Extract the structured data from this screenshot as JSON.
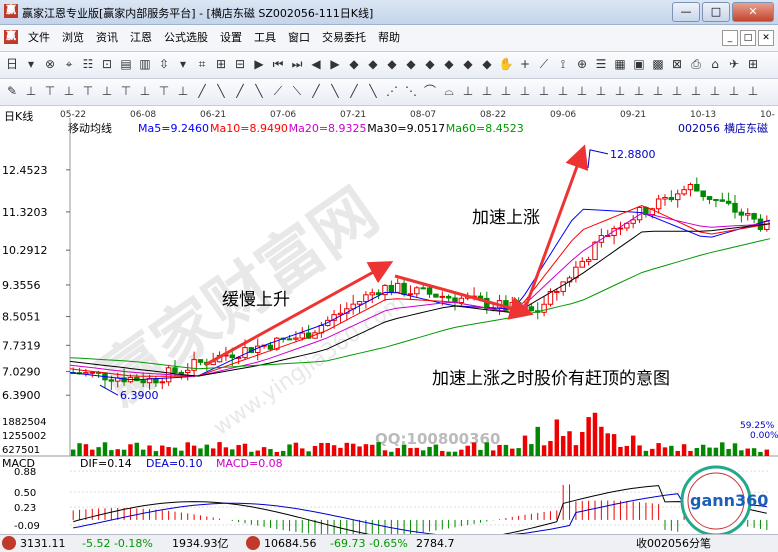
{
  "window": {
    "title": "赢家江恩专业版[赢家内部服务平台] - [横店东磁  SZ002056-111日K线]",
    "app_icon": "赢"
  },
  "window_buttons": [
    "—",
    "□",
    "✕"
  ],
  "menu": {
    "icon": "赢",
    "items": [
      "文件",
      "浏览",
      "资讯",
      "江恩",
      "公式选股",
      "设置",
      "工具",
      "窗口",
      "交易委托",
      "帮助"
    ],
    "mdi": [
      "_",
      "□",
      "✕"
    ]
  },
  "toolbar1": [
    {
      "icon": "日"
    },
    {
      "icon": "▾"
    },
    {
      "icon": "⊗"
    },
    {
      "icon": "⌖"
    },
    {
      "icon": "☷"
    },
    {
      "icon": "⊡"
    },
    {
      "icon": "▤"
    },
    {
      "icon": "▥"
    },
    {
      "icon": "⇳"
    },
    {
      "icon": "▾"
    },
    {
      "icon": "⌗"
    },
    {
      "icon": "⊞"
    },
    {
      "icon": "⊟"
    },
    {
      "icon": "▶"
    },
    {
      "icon": "⏮"
    },
    {
      "icon": "⏭"
    },
    {
      "icon": "◀"
    },
    {
      "icon": "▶"
    },
    {
      "icon": "◆"
    },
    {
      "icon": "◆"
    },
    {
      "icon": "◆"
    },
    {
      "icon": "◆"
    },
    {
      "icon": "◆"
    },
    {
      "icon": "◆"
    },
    {
      "icon": "◆"
    },
    {
      "icon": "◆"
    },
    {
      "icon": "✋"
    },
    {
      "icon": "+"
    },
    {
      "icon": "⟋"
    },
    {
      "icon": "⟟"
    },
    {
      "icon": "⊕"
    },
    {
      "icon": "☰"
    },
    {
      "icon": "▦"
    },
    {
      "icon": "▣"
    },
    {
      "icon": "▩"
    },
    {
      "icon": "⊠"
    },
    {
      "icon": "⎙"
    },
    {
      "icon": "⌂"
    },
    {
      "icon": "✈"
    },
    {
      "icon": "⊞"
    }
  ],
  "toolbar2": [
    "✎",
    "⊥",
    "⊤",
    "⊥",
    "⊤",
    "⊥",
    "⊤",
    "⊥",
    "⊤",
    "⊥",
    "╱",
    "╲",
    "╱",
    "╲",
    "⟋",
    "⟍",
    "╱",
    "╲",
    "╱",
    "╲",
    "⋰",
    "⋱",
    "⌒",
    "⌓",
    "⊥",
    "⊥",
    "⊥",
    "⊥",
    "⊥",
    "⊥",
    "⊥",
    "⊥",
    "⊥",
    "⊥",
    "⊥",
    "⊥",
    "⊥",
    "⊥",
    "⊥",
    "⊥"
  ],
  "chart": {
    "period_label": "日K线",
    "indicator_name": "移动均线",
    "ma_legend": [
      {
        "text": "Ma5=9.2460",
        "color": "#0000ff"
      },
      {
        "text": "Ma10=8.9490",
        "color": "#ff0000"
      },
      {
        "text": "Ma20=8.9325",
        "color": "#cc00cc"
      },
      {
        "text": "Ma30=9.0517",
        "color": "#000000"
      },
      {
        "text": "Ma60=8.4523",
        "color": "#009900"
      }
    ],
    "stock_code": "002056",
    "stock_name": "横店东磁",
    "date_ticks": [
      "05-22",
      "06-08",
      "06-21",
      "07-06",
      "07-21",
      "08-07",
      "08-22",
      "09-06",
      "09-21",
      "10-13",
      "10-"
    ],
    "price_ticks": [
      "12.4523",
      "11.3203",
      "10.2912",
      "9.3556",
      "8.5051",
      "7.7319",
      "7.0290",
      "6.3900"
    ],
    "price_range": [
      6.1,
      13.2
    ],
    "high_label": "12.8800",
    "low_label": "6.3900",
    "volume_ticks": [
      "1882504",
      "1255002",
      "627501"
    ],
    "volume_pct": [
      "59.25%",
      "0.00%"
    ],
    "annotations": [
      "缓慢上升",
      "加速上涨",
      "加速上涨之时股价有赶顶的意图"
    ],
    "watermark": [
      "赢家财富网",
      "www.yingjia360.com",
      "QQ:100800360"
    ],
    "macd": {
      "name": "MACD",
      "dif": "DIF=0.14",
      "dea": "DEA=0.10",
      "macd": "MACD=0.08",
      "ticks": [
        "0.88",
        "0.50",
        "0.23",
        "-0.09"
      ]
    },
    "badge": "gann360"
  },
  "chart_data": {
    "type": "candlestick",
    "title": "横店东磁 002056 日K线",
    "x": [
      "05-22",
      "06-08",
      "06-21",
      "07-06",
      "07-21",
      "08-07",
      "08-22",
      "09-06",
      "09-21",
      "10-13"
    ],
    "ylim": [
      6.1,
      13.2
    ],
    "ma_lines": [
      {
        "name": "Ma5",
        "color": "#0000ff",
        "values": [
          7.0,
          6.8,
          6.9,
          7.7,
          8.3,
          9.2,
          8.8,
          8.7,
          11.4,
          11.3,
          10.6,
          11.1
        ]
      },
      {
        "name": "Ma10",
        "color": "#ff0000",
        "values": [
          7.1,
          6.9,
          6.9,
          7.5,
          8.1,
          9.0,
          8.9,
          8.6,
          10.8,
          11.5,
          10.7,
          11.0
        ]
      },
      {
        "name": "Ma20",
        "color": "#cc00cc",
        "values": [
          7.2,
          7.0,
          6.9,
          7.3,
          7.9,
          8.7,
          8.9,
          8.6,
          10.2,
          11.3,
          10.9,
          11.0
        ]
      },
      {
        "name": "Ma30",
        "color": "#000000",
        "values": [
          7.3,
          7.1,
          6.9,
          7.2,
          7.6,
          8.4,
          8.8,
          8.6,
          9.6,
          10.8,
          10.8,
          11.0
        ]
      },
      {
        "name": "Ma60",
        "color": "#009900",
        "values": [
          7.4,
          7.3,
          7.1,
          7.2,
          7.3,
          7.7,
          8.2,
          8.5,
          8.9,
          9.7,
          10.2,
          10.6
        ]
      }
    ],
    "points": [
      {
        "t": "05-22",
        "v": 7.0
      },
      {
        "t": "06-08",
        "v": 6.8
      },
      {
        "t": "06-21",
        "v": 7.5
      },
      {
        "t": "07-06",
        "v": 8.0
      },
      {
        "t": "07-21",
        "v": 9.3
      },
      {
        "t": "08-07",
        "v": 9.0
      },
      {
        "t": "08-22",
        "v": 8.6
      },
      {
        "t": "09-06",
        "v": 10.9
      },
      {
        "t": "09-21",
        "v": 12.0
      },
      {
        "t": "10-13",
        "v": 10.9
      }
    ],
    "high": 12.88,
    "low": 6.39,
    "volume_max": 1882504
  },
  "status": [
    {
      "text": "3131.11",
      "cls": ""
    },
    {
      "text": "-5.52 -0.18%",
      "cls": "dn"
    },
    {
      "text": "1934.93亿",
      "cls": ""
    },
    {
      "text": "10684.56",
      "cls": ""
    },
    {
      "text": "-69.73 -0.65%",
      "cls": "dn"
    },
    {
      "text": "2784.7",
      "cls": ""
    },
    {
      "text": "收002056分笔",
      "cls": ""
    }
  ]
}
